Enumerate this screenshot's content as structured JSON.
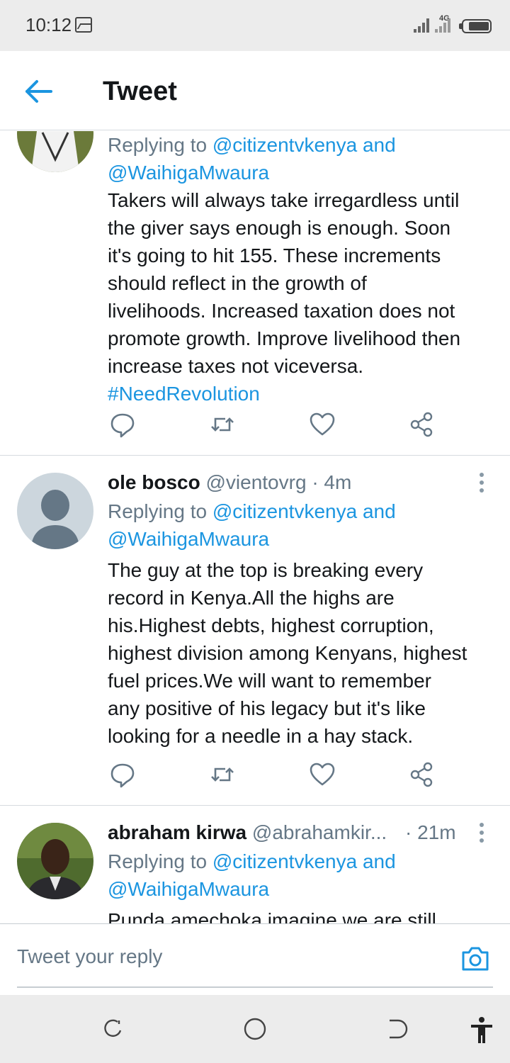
{
  "status_bar": {
    "time": "10:12",
    "network": "4G"
  },
  "header": {
    "back_icon": "back-arrow-icon",
    "title": "Tweet"
  },
  "tweets": [
    {
      "replying_prefix": "Replying to",
      "replying_to_1": "@citizentvkenya and",
      "replying_to_2": "@WaihigaMwaura",
      "body_lines": [
        "Takers will always take irregardless until",
        "the giver says enough is enough. Soon",
        "it's going to hit 155. These increments",
        "should reflect in the growth of",
        "livelihoods. Increased taxation does not",
        "promote growth. Improve livelihood then",
        "increase taxes not viceversa."
      ],
      "hashtag": "#NeedRevolution"
    },
    {
      "name": "ole bosco",
      "handle": "@vientovrg",
      "time": "· 4m",
      "replying_prefix": "Replying to",
      "replying_to_1": "@citizentvkenya and",
      "replying_to_2": "@WaihigaMwaura",
      "body_lines": [
        "The guy at the top is breaking every",
        "record in Kenya.All the highs are",
        "his.Highest debts, highest corruption,",
        "highest division among Kenyans, highest",
        "fuel prices.We will want to remember",
        "any positive of his legacy but it's like",
        "looking for a needle in a hay stack."
      ]
    },
    {
      "name": "abraham kirwa",
      "handle": "@abrahamkir...",
      "time": "· 21m",
      "replying_prefix": "Replying to",
      "replying_to_1": "@citizentvkenya and",
      "replying_to_2": "@WaihigaMwaura",
      "body_lines": [
        "Punda amechoka imagine we are still"
      ]
    }
  ],
  "actions": [
    "reply-icon",
    "retweet-icon",
    "like-icon",
    "share-icon"
  ],
  "reply_bar": {
    "placeholder": "Tweet your reply",
    "camera_icon": "camera-icon"
  },
  "nav_bar": [
    "recents-icon",
    "home-icon",
    "back-icon",
    "accessibility-icon"
  ],
  "colors": {
    "accent": "#1b95e0",
    "secondary_text": "#657786",
    "divider": "#d6dbdf"
  }
}
